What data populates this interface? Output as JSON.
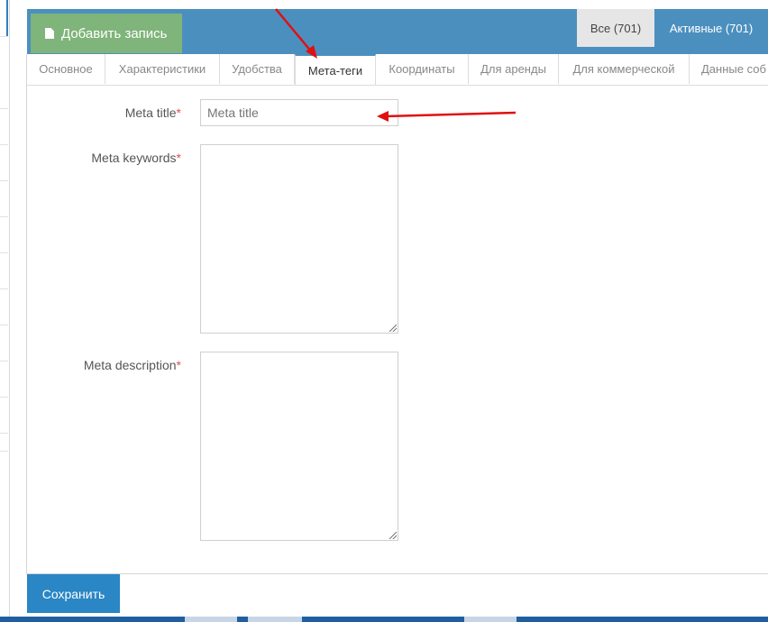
{
  "toolbar": {
    "add_label": "Добавить запись",
    "filter_all": "Все (701)",
    "filter_active": "Активные (701)"
  },
  "tabs": [
    {
      "label": "Основное"
    },
    {
      "label": "Характеристики"
    },
    {
      "label": "Удобства"
    },
    {
      "label": "Мета-теги"
    },
    {
      "label": "Координаты"
    },
    {
      "label": "Для аренды"
    },
    {
      "label": "Для коммерческой"
    },
    {
      "label": "Данные соб"
    }
  ],
  "active_tab": "Мета-теги",
  "form": {
    "meta_title_label": "Meta title",
    "meta_title_placeholder": "Meta title",
    "meta_title_value": "",
    "meta_keywords_label": "Meta keywords",
    "meta_description_label": "Meta description",
    "required_mark": "*"
  },
  "footer": {
    "save_label": "Сохранить"
  },
  "colors": {
    "header_bg": "#4b8fbf",
    "add_button_bg": "#7fb47a",
    "save_button_bg": "#2a86c4",
    "required": "#d9534f",
    "annotation_arrow": "#e01010"
  },
  "icons": {
    "add_button_icon": "document-icon"
  }
}
